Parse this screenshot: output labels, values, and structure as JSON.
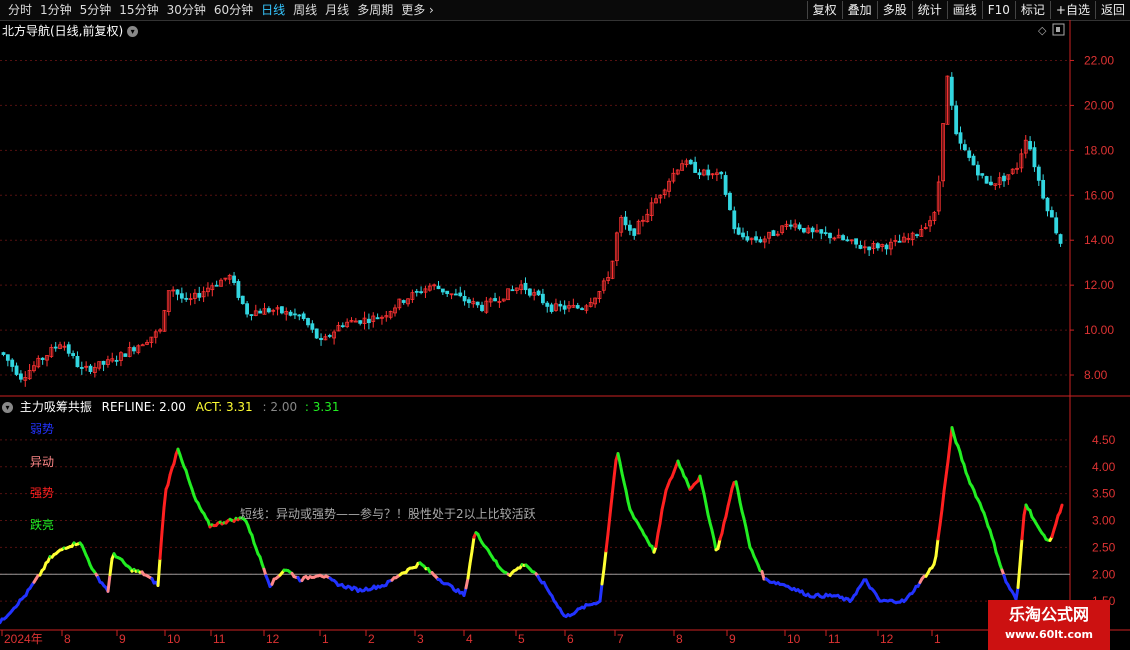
{
  "toolbar": {
    "periods": [
      "分时",
      "1分钟",
      "5分钟",
      "15分钟",
      "30分钟",
      "60分钟",
      "日线",
      "周线",
      "月线",
      "多周期",
      "更多"
    ],
    "active_period": "日线",
    "tools": [
      "复权",
      "叠加",
      "多股",
      "统计",
      "画线",
      "F10",
      "标记",
      "+自选",
      "返回"
    ]
  },
  "main_chart": {
    "title": "北方导航(日线,前复权)",
    "y_ticks": [
      "22.00",
      "20.00",
      "18.00",
      "16.00",
      "14.00",
      "12.00",
      "10.00",
      "8.00"
    ],
    "y_range": [
      7.2,
      23.0
    ]
  },
  "indicator": {
    "name": "主力吸筹共振",
    "refline_label": "REFLINE:",
    "refline_value": "2.00",
    "act_label": "ACT:",
    "act_value": "3.31",
    "extra1": ": 2.00",
    "extra2": ": 3.31",
    "y_ticks": [
      "4.50",
      "4.00",
      "3.50",
      "3.00",
      "2.50",
      "2.00",
      "1.50"
    ],
    "y_range": [
      1.0,
      5.0
    ],
    "legend": [
      {
        "label": "弱势",
        "color": "#2233ff"
      },
      {
        "label": "异动",
        "color": "#ff8888"
      },
      {
        "label": "强势",
        "color": "#ff2020"
      },
      {
        "label": "跌亮",
        "color": "#22ee22"
      }
    ],
    "note": "短线：异动或强势——参与？！股性处于2以上比较活跃"
  },
  "x_axis": {
    "labels": [
      "2024年",
      "8",
      "9",
      "10",
      "11",
      "12",
      "1",
      "2",
      "3",
      "4",
      "5",
      "6",
      "7",
      "8",
      "9",
      "10",
      "11",
      "12",
      "1"
    ]
  },
  "colors": {
    "up": "#ff3333",
    "down": "#33d6e0",
    "grid": "#551111",
    "axis": "#cc2222",
    "weak": "#2233ff",
    "abnormal": "#ff8888",
    "strong": "#ff2020",
    "green": "#22ee22",
    "yellow": "#ffff33"
  },
  "chart_data": {
    "type": "line",
    "price_anchors": [
      [
        0,
        9.0
      ],
      [
        20,
        7.9
      ],
      [
        60,
        9.5
      ],
      [
        80,
        8.2
      ],
      [
        110,
        8.6
      ],
      [
        160,
        10.0
      ],
      [
        168,
        12.0
      ],
      [
        185,
        11.2
      ],
      [
        210,
        12.0
      ],
      [
        228,
        12.4
      ],
      [
        245,
        10.8
      ],
      [
        270,
        10.9
      ],
      [
        300,
        10.6
      ],
      [
        320,
        9.4
      ],
      [
        340,
        10.3
      ],
      [
        380,
        10.6
      ],
      [
        400,
        11.3
      ],
      [
        430,
        12.0
      ],
      [
        470,
        11.2
      ],
      [
        480,
        11.0
      ],
      [
        520,
        12.0
      ],
      [
        550,
        11.0
      ],
      [
        580,
        11.0
      ],
      [
        600,
        11.8
      ],
      [
        610,
        12.8
      ],
      [
        618,
        15.0
      ],
      [
        630,
        14.2
      ],
      [
        660,
        16.2
      ],
      [
        680,
        17.5
      ],
      [
        700,
        17.0
      ],
      [
        720,
        16.8
      ],
      [
        735,
        14.2
      ],
      [
        760,
        14.0
      ],
      [
        790,
        14.8
      ],
      [
        810,
        14.3
      ],
      [
        830,
        14.2
      ],
      [
        860,
        13.7
      ],
      [
        890,
        13.8
      ],
      [
        910,
        14.1
      ],
      [
        935,
        15.2
      ],
      [
        945,
        21.5
      ],
      [
        955,
        18.5
      ],
      [
        985,
        16.5
      ],
      [
        1000,
        16.7
      ],
      [
        1015,
        17.2
      ],
      [
        1025,
        18.7
      ],
      [
        1040,
        16.2
      ],
      [
        1060,
        13.8
      ]
    ],
    "indicator_anchors": [
      [
        0,
        1.1
      ],
      [
        25,
        1.6
      ],
      [
        40,
        2.0
      ],
      [
        50,
        2.3
      ],
      [
        65,
        2.5
      ],
      [
        80,
        2.6
      ],
      [
        95,
        2.0
      ],
      [
        108,
        1.7
      ],
      [
        113,
        2.4
      ],
      [
        130,
        2.1
      ],
      [
        145,
        2.0
      ],
      [
        158,
        1.8
      ],
      [
        165,
        3.5
      ],
      [
        178,
        4.35
      ],
      [
        195,
        3.4
      ],
      [
        210,
        2.9
      ],
      [
        230,
        3.0
      ],
      [
        245,
        3.05
      ],
      [
        260,
        2.3
      ],
      [
        270,
        1.8
      ],
      [
        285,
        2.1
      ],
      [
        300,
        1.9
      ],
      [
        320,
        2.0
      ],
      [
        340,
        1.8
      ],
      [
        360,
        1.7
      ],
      [
        385,
        1.8
      ],
      [
        400,
        2.0
      ],
      [
        420,
        2.2
      ],
      [
        440,
        1.9
      ],
      [
        465,
        1.6
      ],
      [
        475,
        2.8
      ],
      [
        490,
        2.4
      ],
      [
        500,
        2.1
      ],
      [
        510,
        2.0
      ],
      [
        525,
        2.2
      ],
      [
        545,
        1.8
      ],
      [
        565,
        1.2
      ],
      [
        585,
        1.4
      ],
      [
        600,
        1.5
      ],
      [
        607,
        2.6
      ],
      [
        617,
        4.3
      ],
      [
        630,
        3.2
      ],
      [
        655,
        2.4
      ],
      [
        665,
        3.5
      ],
      [
        678,
        4.1
      ],
      [
        690,
        3.6
      ],
      [
        700,
        3.8
      ],
      [
        717,
        2.4
      ],
      [
        735,
        3.8
      ],
      [
        750,
        2.5
      ],
      [
        765,
        1.9
      ],
      [
        785,
        1.8
      ],
      [
        810,
        1.6
      ],
      [
        835,
        1.6
      ],
      [
        850,
        1.5
      ],
      [
        865,
        1.9
      ],
      [
        880,
        1.5
      ],
      [
        905,
        1.5
      ],
      [
        920,
        1.85
      ],
      [
        935,
        2.2
      ],
      [
        952,
        4.7
      ],
      [
        968,
        3.8
      ],
      [
        985,
        3.1
      ],
      [
        1005,
        1.9
      ],
      [
        1017,
        1.5
      ],
      [
        1025,
        3.35
      ],
      [
        1040,
        2.8
      ],
      [
        1050,
        2.6
      ],
      [
        1062,
        3.3
      ]
    ]
  }
}
